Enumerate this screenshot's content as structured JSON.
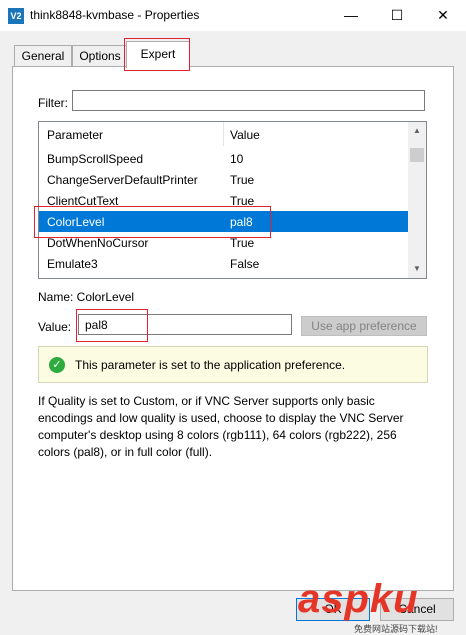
{
  "window": {
    "icon_text": "V2",
    "title": "think8848-kvmbase - Properties",
    "min_symbol": "—",
    "max_symbol": "☐",
    "close_symbol": "✕"
  },
  "tabs": [
    {
      "label": "General"
    },
    {
      "label": "Options"
    },
    {
      "label": "Expert"
    }
  ],
  "filter": {
    "label": "Filter:",
    "value": ""
  },
  "table": {
    "headers": [
      "Parameter",
      "Value"
    ],
    "rows": [
      {
        "param": "BumpScrollSpeed",
        "value": "10"
      },
      {
        "param": "ChangeServerDefaultPrinter",
        "value": "True"
      },
      {
        "param": "ClientCutText",
        "value": "True"
      },
      {
        "param": "ColorLevel",
        "value": "pal8"
      },
      {
        "param": "DotWhenNoCursor",
        "value": "True"
      },
      {
        "param": "Emulate3",
        "value": "False"
      }
    ]
  },
  "name_line": "Name: ColorLevel",
  "value_field": {
    "label": "Value:",
    "value": "pal8"
  },
  "use_app_button": "Use app preference",
  "info": {
    "text": "This parameter is set to the application preference.",
    "icon": "check-circle-icon",
    "color": "#2eab3f"
  },
  "description": "If Quality is set to Custom, or if VNC Server supports only basic encodings and low quality is used, choose to display the VNC Server computer's desktop using 8 colors (rgb111), 64 colors (rgb222), 256 colors (pal8), or in full color (full).",
  "buttons": {
    "ok": "OK",
    "cancel": "Cancel"
  },
  "watermark": {
    "big": "aspku",
    "small": "免费网站源码下载站!"
  },
  "colors": {
    "selection": "#0078d7",
    "highlight": "#e0232e",
    "info_bg": "#fcfce2"
  }
}
